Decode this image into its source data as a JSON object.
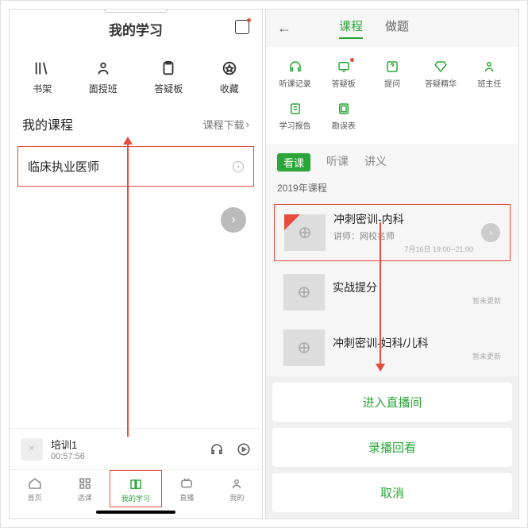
{
  "left": {
    "title": "我的学习",
    "shortcuts": [
      {
        "label": "书架"
      },
      {
        "label": "面授班"
      },
      {
        "label": "答疑板"
      },
      {
        "label": "收藏"
      }
    ],
    "section_title": "我的课程",
    "section_link": "课程下载",
    "course_name": "临床执业医师",
    "now_playing": {
      "title": "培训1",
      "time": "00:57:56"
    },
    "nav": [
      {
        "label": "首页"
      },
      {
        "label": "选课"
      },
      {
        "label": "我的学习"
      },
      {
        "label": "直播"
      },
      {
        "label": "我的"
      }
    ]
  },
  "right": {
    "tabs": [
      {
        "label": "课程"
      },
      {
        "label": "做题"
      }
    ],
    "shortcuts": [
      {
        "label": "听课记录"
      },
      {
        "label": "答疑板"
      },
      {
        "label": "提问"
      },
      {
        "label": "答疑精华"
      },
      {
        "label": "班主任"
      },
      {
        "label": "学习报告"
      },
      {
        "label": "勘误表"
      }
    ],
    "sub_tabs": [
      {
        "label": "看课"
      },
      {
        "label": "听课"
      },
      {
        "label": "讲义"
      }
    ],
    "year": "2019年课程",
    "lessons": [
      {
        "title": "冲刺密训-内科",
        "teacher": "讲师：网校名师",
        "time": "7月16日 19:00--21:00"
      },
      {
        "title": "实战提分",
        "teacher": "",
        "note": "暂未更新"
      },
      {
        "title": "冲刺密训-妇科/儿科",
        "teacher": "",
        "note": "暂未更新"
      }
    ],
    "actions": {
      "enter": "进入直播间",
      "replay": "录播回看",
      "cancel": "取消"
    }
  }
}
